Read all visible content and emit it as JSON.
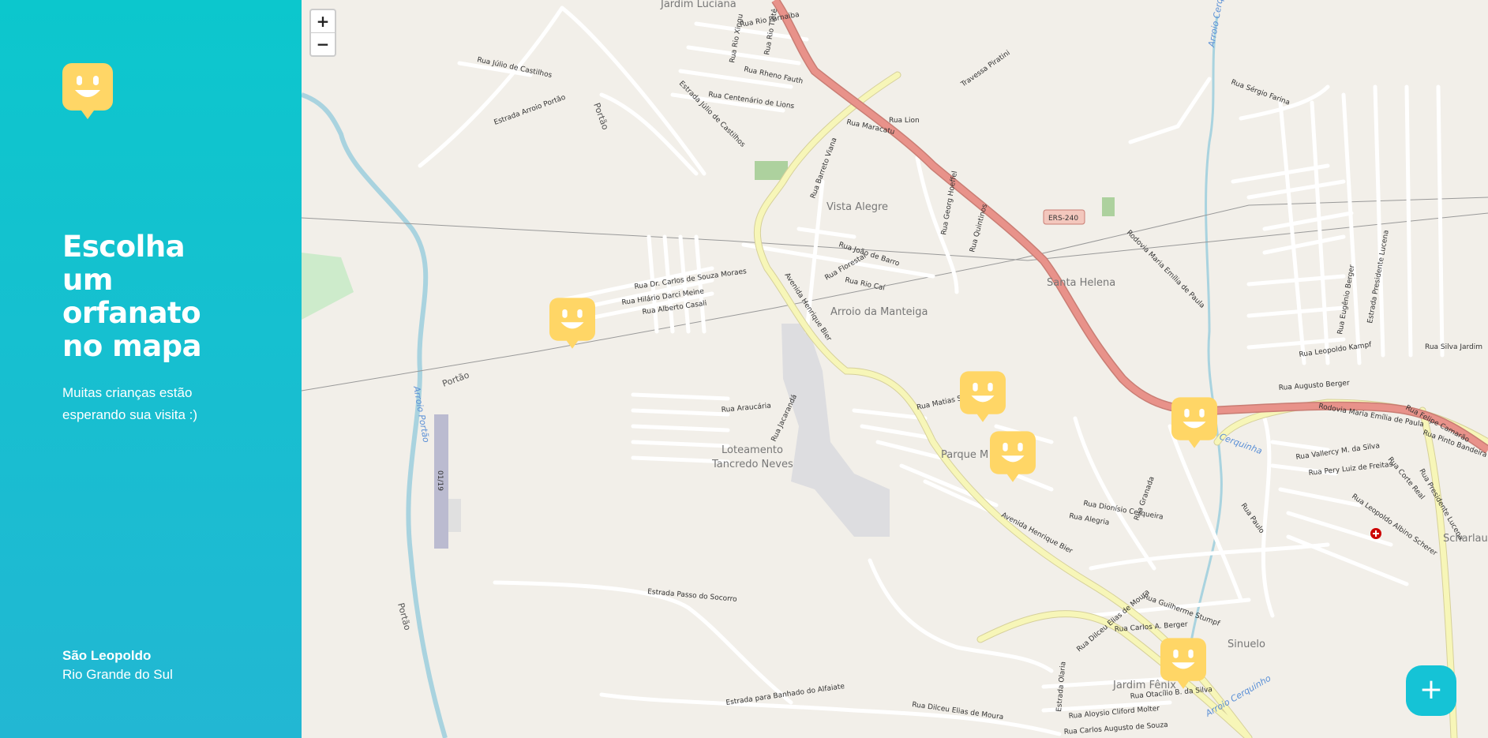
{
  "sidebar": {
    "title": "Escolha um orfanato no mapa",
    "subtitle": "Muitas crianças estão esperando sua visita :)",
    "city": "São Leopoldo",
    "state": "Rio Grande do Sul"
  },
  "map": {
    "zoom_in": "+",
    "zoom_out": "−",
    "add_button": "+",
    "places": {
      "jardim_luciana": "Jardim Luciana",
      "vista_alegre": "Vista Alegre",
      "santa_helena": "Santa Helena",
      "arroio_manteiga": "Arroio da Manteiga",
      "parque": "Parque M",
      "loteamento": "Loteamento",
      "tancredo": "Tancredo Neves",
      "sinuelo": "Sinuelo",
      "jardim_fenix": "Jardim Fênix",
      "scharlau": "Scharlau",
      "portao1": "Portão",
      "portao2": "Portão",
      "portao3": "Portão"
    },
    "streets": {
      "ers": "ERS-240",
      "rodovia1": "Rodovia Maria Emília de Paula",
      "rodovia2": "Rodovia Maria Emília de Paula",
      "henrique1": "Avenida Henrique Bier",
      "henrique2": "Avenida Henrique Bier",
      "barreto": "Rua Barreto Viana",
      "julio": "Estrada Júlio de Castilhos",
      "rua_julio": "Rua Júlio de Castilhos",
      "arroio_portao": "Estrada Arroio Portão",
      "passo": "Estrada Passo do Socorro",
      "banhado": "Estrada para Banhado do Alfaiate",
      "dilceu": "Rua Dilceu Elias de Moura",
      "dilceu2": "Rua Dilceu Elias de Moura",
      "carlos": "Rua Dr. Carlos de Souza Moraes",
      "hilario": "Rua Hilário Darci Meine",
      "alberto": "Rua Alberto Casali",
      "georg": "Rua Georg Hoeffel",
      "joao": "Rua João de Barro",
      "florestal": "Rua Florestal",
      "caj": "Rua Rio Caí",
      "rio_paranaiba": "Rua Rio Parnaiba",
      "centenario": "Rua Centenário de Lions",
      "maracatu": "Rua Maracatu",
      "lion": "Rua Lion",
      "sergio": "Rua Sérgio Farina",
      "silva": "Rua Silva Jardim",
      "augusto": "Rua Augusto Berger",
      "leopoldo": "Rua Leopoldo Kampf",
      "eugenio": "Rua Eugênio Berger",
      "presidente": "Estrada Presidente Lucena",
      "presidente2": "Rua Presidente Lucena",
      "matias": "Rua Matias Sch",
      "araucaria": "Rua Araucária",
      "jacaranda": "Rua Jacarandá",
      "vallercy": "Rua Vallercy M. da Silva",
      "pery": "Rua Pery Luiz de Freitas",
      "leopoldo_albino": "Rua Leopoldo Albino Scherer",
      "guilherme": "Rua Guilherme Stumpf",
      "carlos_berger": "Rua Carlos A. Berger",
      "otacilio": "Rua Otacílio B. da Silva",
      "aloysio": "Rua Aloysio Cliford Molter",
      "carlos_augusto": "Rua Carlos Augusto de Souza",
      "olaria": "Estrada Olaria",
      "paulo": "Rua Paulo",
      "arroio_cerquinha": "Arroio Cerquinha",
      "arroio_portao_blue": "Arroio Portão",
      "cerquinha2": "Cerquinha",
      "cerquinha3": "Arroio Cerquinho",
      "runway": "01/19",
      "travessa": "Travessa Piratini",
      "sheet_rio_xingu": "Rua Rio Xingu",
      "sheet_rio_tiete": "Rua Rio Tietê",
      "rheno": "Rua Rheno Fauth",
      "quintinos": "Rua Quintinos",
      "dionisio": "Rua Dionísio Cerqueira",
      "alegria": "Rua Alegria",
      "grenada": "Rua Granada",
      "felipe": "Rua Felipe Camarão",
      "corte": "Rua Corte Real",
      "pinto": "Rua Pinto Bandeira"
    }
  },
  "markers_count_label": "",
  "colors": {
    "sidebar_top": "#0cc7cd",
    "sidebar_bottom": "#22b7d3",
    "marker": "#ffd666",
    "fab": "#15c3d6",
    "map_bg": "#f2efe9",
    "highway": "#e8928a",
    "main_road": "#f7f6b8"
  },
  "icons": [
    "smiley-logo-icon",
    "smiley-marker-icon",
    "plus-icon",
    "minus-icon"
  ]
}
